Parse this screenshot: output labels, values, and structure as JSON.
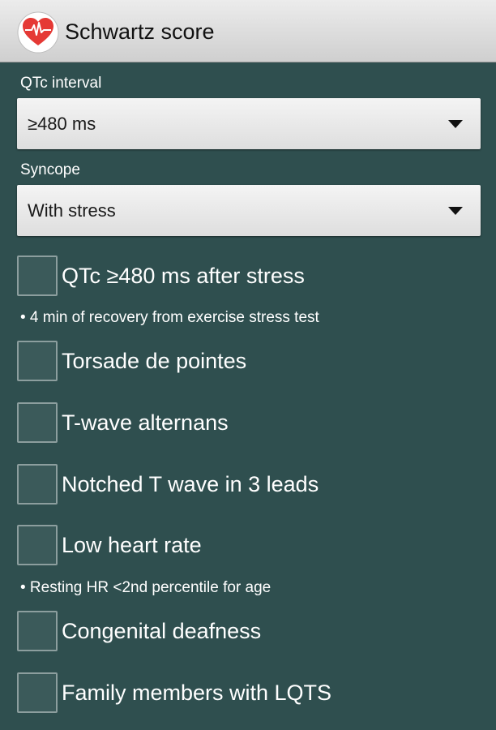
{
  "header": {
    "title": "Schwartz score",
    "icon": "heart-ecg-icon",
    "accent_color": "#e53935"
  },
  "qtc": {
    "label": "QTc interval",
    "value": "≥480 ms"
  },
  "syncope": {
    "label": "Syncope",
    "value": "With stress"
  },
  "criteria": [
    {
      "label": "QTc ≥480 ms after stress",
      "note": "• 4 min of recovery from exercise stress test",
      "checked": false
    },
    {
      "label": "Torsade de pointes",
      "checked": false
    },
    {
      "label": "T-wave alternans",
      "checked": false
    },
    {
      "label": "Notched T wave in 3 leads",
      "checked": false
    },
    {
      "label": "Low heart rate",
      "note": "• Resting HR <2nd percentile for age",
      "checked": false
    },
    {
      "label": "Congenital deafness",
      "checked": false
    },
    {
      "label": "Family members with LQTS",
      "checked": false
    }
  ],
  "colors": {
    "background": "#2f4f4f",
    "app_bar": "#dcdcdc",
    "select": "#ececec"
  }
}
